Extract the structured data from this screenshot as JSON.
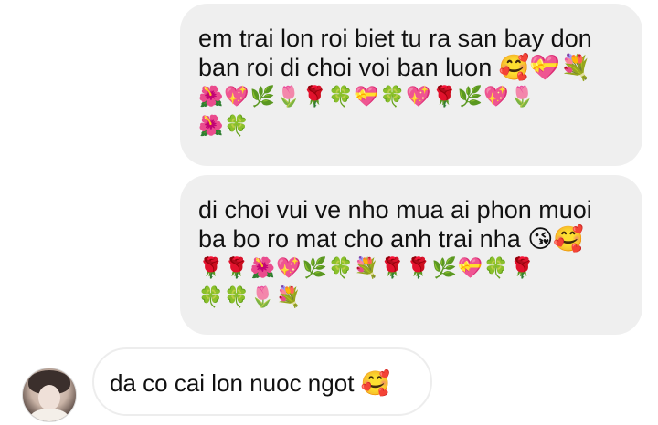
{
  "messages": [
    {
      "direction": "sent",
      "lines": [
        "em trai lon roi biet tu ra san bay don",
        "ban roi di choi voi ban luon 🥰💝💐"
      ],
      "emoji_lines": [
        "🌺💖🌿🌷🌹🍀💝🍀💖🌹🌿💖🌷",
        "🌺🍀"
      ]
    },
    {
      "direction": "sent",
      "lines": [
        "di choi vui ve nho mua ai phon muoi",
        "ba bo ro mat cho anh trai nha 😘🥰"
      ],
      "emoji_lines": [
        "🌹🌹🌺💖🌿🍀💐🌹🌹🌿💝🍀🌹",
        "🍀🍀🌷💐"
      ]
    },
    {
      "direction": "received",
      "text": "da co cai lon nuoc ngot 🥰"
    }
  ],
  "colors": {
    "sent_bubble": "#efefef",
    "received_border": "#ededed",
    "text": "#111111"
  }
}
